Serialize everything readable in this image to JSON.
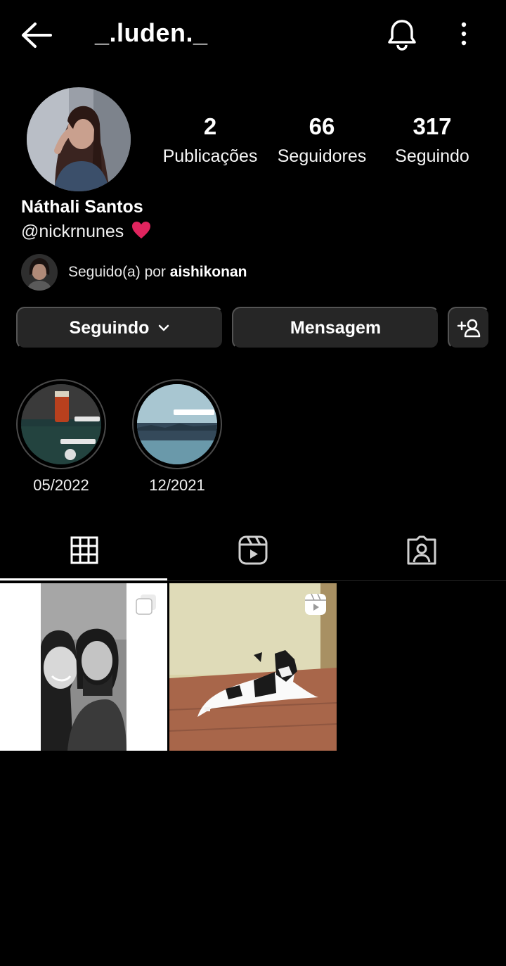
{
  "header": {
    "username": "_.luden._"
  },
  "profile": {
    "stats": [
      {
        "value": "2",
        "label": "Publicações"
      },
      {
        "value": "66",
        "label": "Seguidores"
      },
      {
        "value": "317",
        "label": "Seguindo"
      }
    ],
    "full_name": "Náthali Santos",
    "bio": "@nickrnunes",
    "followed_by_prefix": "Seguido(a) por ",
    "followed_by_user": "aishikonan"
  },
  "actions": {
    "following_label": "Seguindo",
    "message_label": "Mensagem"
  },
  "highlights": [
    {
      "label": "05/2022"
    },
    {
      "label": "12/2021"
    }
  ],
  "tabs": [
    {
      "icon": "grid-icon",
      "active": true
    },
    {
      "icon": "reels-icon",
      "active": false
    },
    {
      "icon": "tagged-icon",
      "active": false
    }
  ],
  "posts": [
    {
      "type": "carousel",
      "badge_icon": "multiple-photos-icon"
    },
    {
      "type": "reel",
      "badge_icon": "reels-icon"
    }
  ],
  "colors": {
    "background": "#000000",
    "button_bg": "#262626",
    "heart": "#e0245e"
  }
}
